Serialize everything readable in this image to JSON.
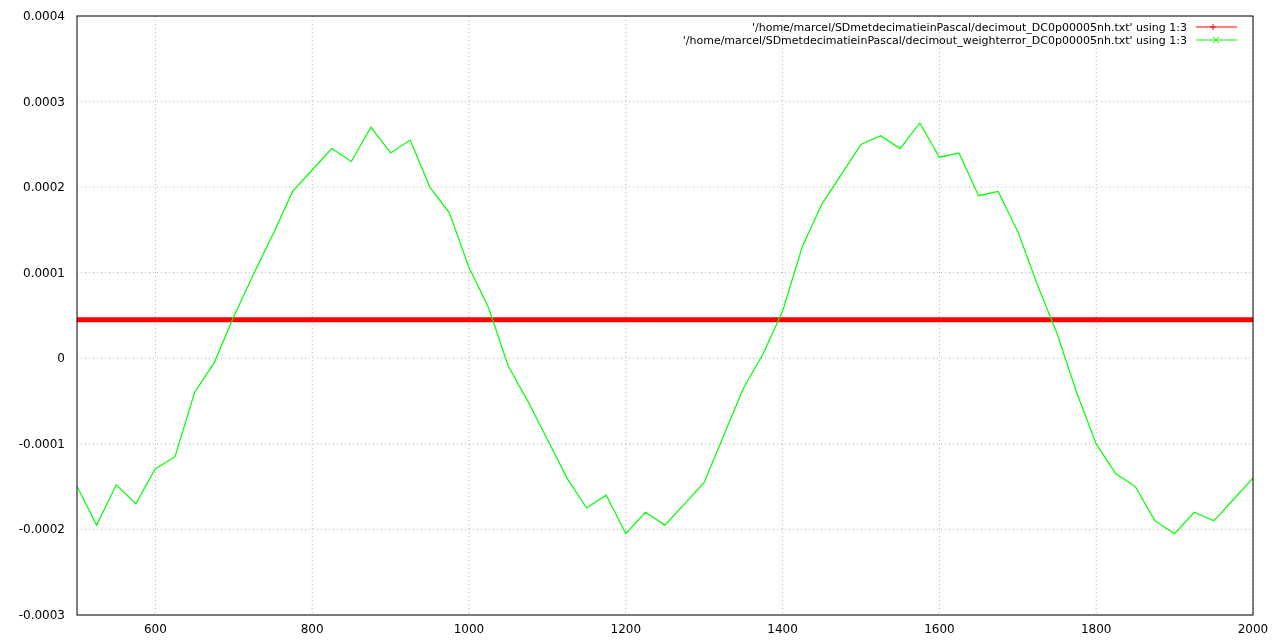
{
  "chart_data": {
    "type": "line",
    "x": [
      500,
      525,
      550,
      575,
      600,
      625,
      650,
      675,
      700,
      725,
      750,
      775,
      800,
      825,
      850,
      875,
      900,
      925,
      950,
      975,
      1000,
      1025,
      1050,
      1075,
      1100,
      1125,
      1150,
      1175,
      1200,
      1225,
      1250,
      1275,
      1300,
      1325,
      1350,
      1375,
      1400,
      1425,
      1450,
      1475,
      1500,
      1525,
      1550,
      1575,
      1600,
      1625,
      1650,
      1675,
      1700,
      1725,
      1750,
      1775,
      1800,
      1825,
      1850,
      1875,
      1900,
      1925,
      1950,
      1975,
      2000
    ],
    "series": [
      {
        "name": "'/home/marcel/SDmetdecimatieinPascal/decimout_DC0p00005nh.txt' using 1:3",
        "color": "#ff0000",
        "values": [
          4.5e-05,
          4.5e-05,
          4.5e-05,
          4.5e-05,
          4.5e-05,
          4.5e-05,
          4.5e-05,
          4.5e-05,
          4.5e-05,
          4.5e-05,
          4.5e-05,
          4.5e-05,
          4.5e-05,
          4.5e-05,
          4.5e-05,
          4.5e-05,
          4.5e-05,
          4.5e-05,
          4.5e-05,
          4.5e-05,
          4.5e-05,
          4.5e-05,
          4.5e-05,
          4.5e-05,
          4.5e-05,
          4.5e-05,
          4.5e-05,
          4.5e-05,
          4.5e-05,
          4.5e-05,
          4.5e-05,
          4.5e-05,
          4.5e-05,
          4.5e-05,
          4.5e-05,
          4.5e-05,
          4.5e-05,
          4.5e-05,
          4.5e-05,
          4.5e-05,
          4.5e-05,
          4.5e-05,
          4.5e-05,
          4.5e-05,
          4.5e-05,
          4.5e-05,
          4.5e-05,
          4.5e-05,
          4.5e-05,
          4.5e-05,
          4.5e-05,
          4.5e-05,
          4.5e-05,
          4.5e-05,
          4.5e-05,
          4.5e-05,
          4.5e-05,
          4.5e-05,
          4.5e-05,
          4.5e-05,
          4.5e-05
        ]
      },
      {
        "name": "'/home/marcel/SDmetdecimatieinPascal/decimout_weighterror_DC0p00005nh.txt' using 1:3",
        "color": "#00ff00",
        "values": [
          -0.00015,
          -0.000195,
          -0.000148,
          -0.00017,
          -0.000129,
          -0.000115,
          -4e-05,
          -5e-06,
          4.9e-05,
          9.8e-05,
          0.000145,
          0.000195,
          0.00022,
          0.000245,
          0.00023,
          0.00027,
          0.00024,
          0.000255,
          0.0002,
          0.00017,
          0.000106,
          5.9e-05,
          -9e-06,
          -5e-05,
          -9.5e-05,
          -0.00014,
          -0.000175,
          -0.00016,
          -0.000205,
          -0.00018,
          -0.000195,
          -0.00017,
          -0.000145,
          -9e-05,
          -3.5e-05,
          5e-06,
          5.5e-05,
          0.00013,
          0.00018,
          0.000215,
          0.00025,
          0.00026,
          0.000245,
          0.000275,
          0.000235,
          0.00024,
          0.00019,
          0.000195,
          0.000148,
          8.6e-05,
          2.9e-05,
          -4e-05,
          -0.0001,
          -0.000135,
          -0.00015,
          -0.00019,
          -0.000205,
          -0.00018,
          -0.00019,
          -0.000165,
          -0.00014
        ]
      }
    ],
    "xlim": [
      500,
      2000
    ],
    "ylim": [
      -0.0003,
      0.0004
    ],
    "xticks": [
      600,
      800,
      1000,
      1200,
      1400,
      1600,
      1800,
      2000
    ],
    "yticks": [
      -0.0003,
      -0.0002,
      -0.0001,
      0,
      0.0001,
      0.0002,
      0.0003,
      0.0004
    ],
    "grid": true,
    "legend": true
  }
}
